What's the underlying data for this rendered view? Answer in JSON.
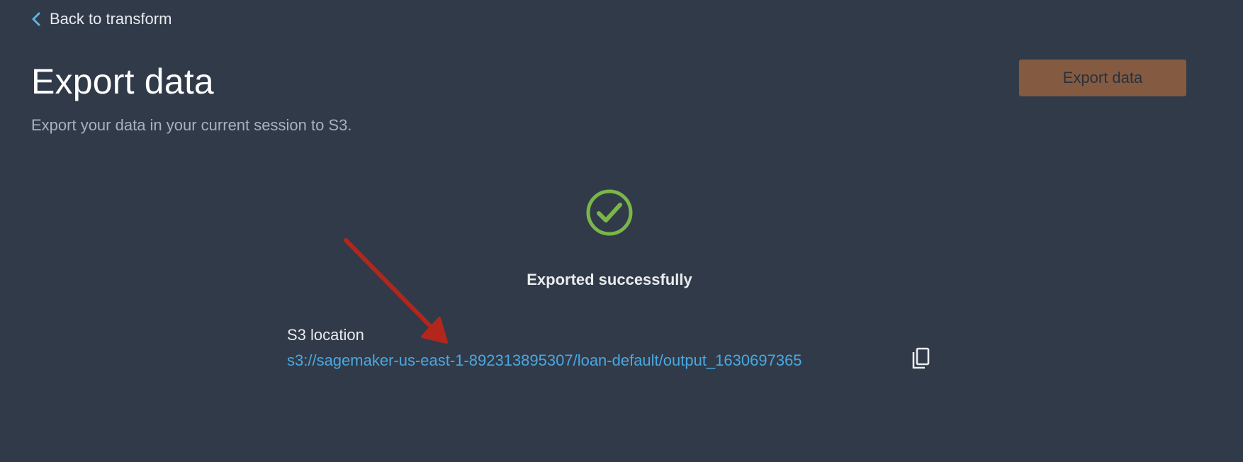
{
  "nav": {
    "back_label": "Back to transform"
  },
  "header": {
    "title": "Export data",
    "subtitle": "Export your data in your current session to S3.",
    "export_button_label": "Export data"
  },
  "result": {
    "status_text": "Exported successfully",
    "s3_label": "S3 location",
    "s3_uri": "s3://sagemaker-us-east-1-892313895307/loan-default/output_1630697365"
  },
  "icons": {
    "back": "chevron-left-icon",
    "success": "check-circle-icon",
    "copy": "copy-icon",
    "annotation": "red-arrow-annotation"
  },
  "colors": {
    "background": "#313a49",
    "accent_link": "#4aa8e0",
    "success_green": "#7ab648",
    "button_bg": "#845b40",
    "annotation_red": "#b3261e"
  }
}
